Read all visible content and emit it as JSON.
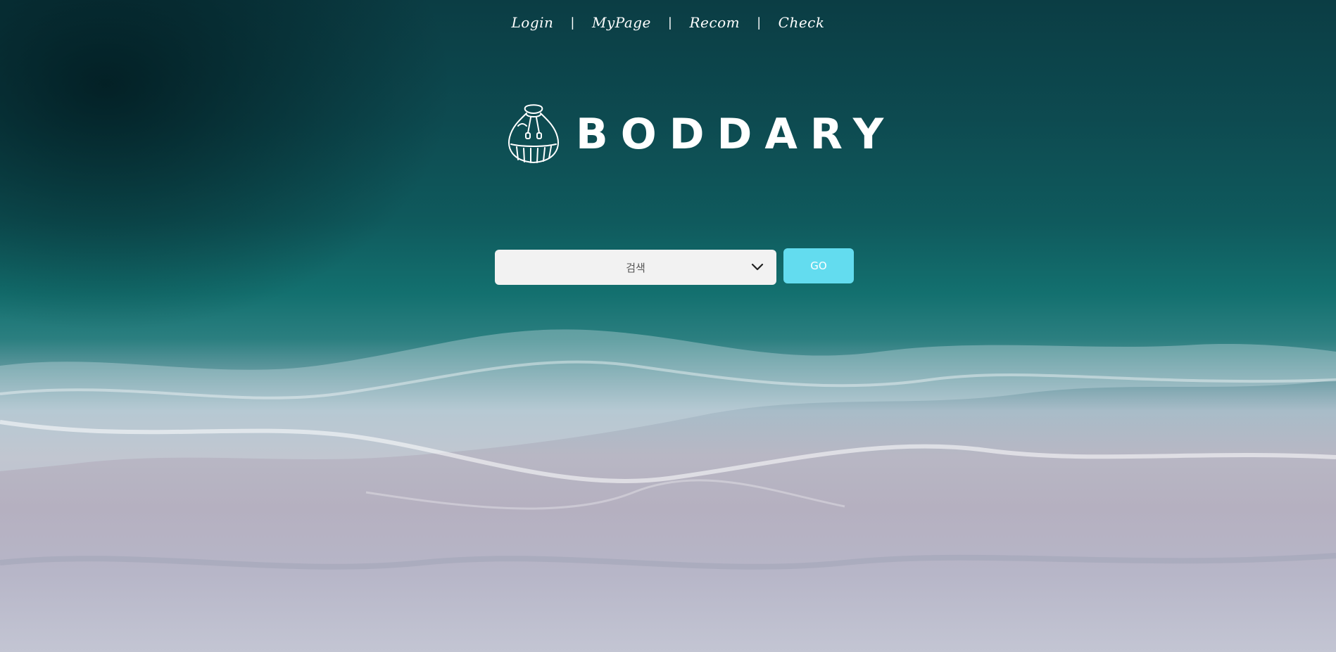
{
  "nav": {
    "items": [
      {
        "label": "Login"
      },
      {
        "label": "MyPage"
      },
      {
        "label": "Recom"
      },
      {
        "label": "Check"
      }
    ],
    "separator": "|"
  },
  "logo": {
    "text": "BODDARY",
    "icon": "pouch-icon"
  },
  "search": {
    "selected": "검색",
    "go_label": "GO",
    "chevron_icon": "chevron-down-icon"
  },
  "colors": {
    "go_button": "#63dcef",
    "select_bg": "#f2f2f2",
    "nav_text": "#ffffff"
  }
}
